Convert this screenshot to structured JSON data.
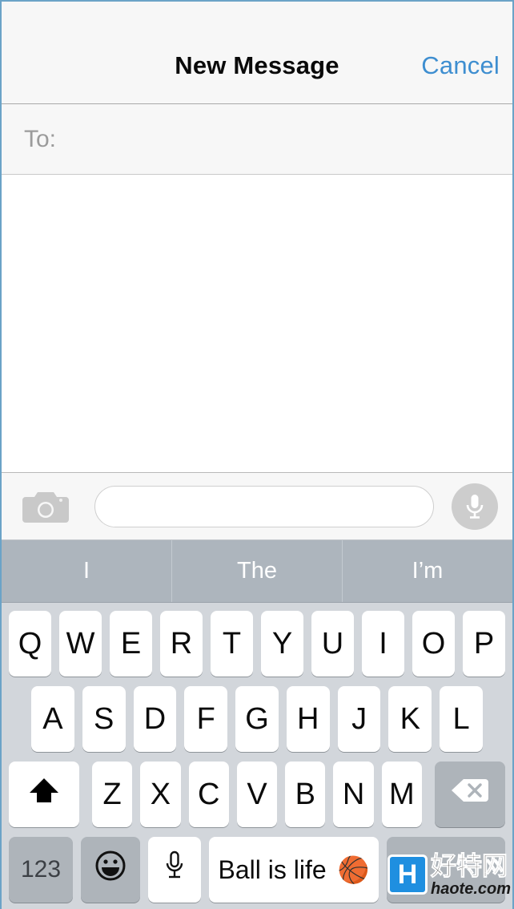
{
  "navbar": {
    "title": "New Message",
    "cancel_label": "Cancel",
    "cancel_color": "#3e8ed0"
  },
  "recipients": {
    "to_label": "To:"
  },
  "compose": {
    "camera_icon": "camera-icon",
    "input_value": "",
    "input_placeholder": "",
    "mic_icon": "microphone-icon"
  },
  "predictive": {
    "suggestions": [
      "I",
      "The",
      "I’m"
    ]
  },
  "keyboard": {
    "row1": [
      "Q",
      "W",
      "E",
      "R",
      "T",
      "Y",
      "U",
      "I",
      "O",
      "P"
    ],
    "row2": [
      "A",
      "S",
      "D",
      "F",
      "G",
      "H",
      "J",
      "K",
      "L"
    ],
    "row3": [
      "Z",
      "X",
      "C",
      "V",
      "B",
      "N",
      "M"
    ],
    "shift_icon": "shift-arrow-icon",
    "delete_icon": "backspace-icon",
    "numbers_label": "123",
    "emoji_icon": "smiley-face-icon",
    "dictation_icon": "microphone-icon",
    "space_label": "Ball is life",
    "space_emoji": "🏀",
    "return_label": ""
  },
  "watermark": {
    "logo_letter": "H",
    "site_name_cn": "好特网",
    "site_url": "haote.com",
    "logo_color": "#1f8fe0"
  }
}
